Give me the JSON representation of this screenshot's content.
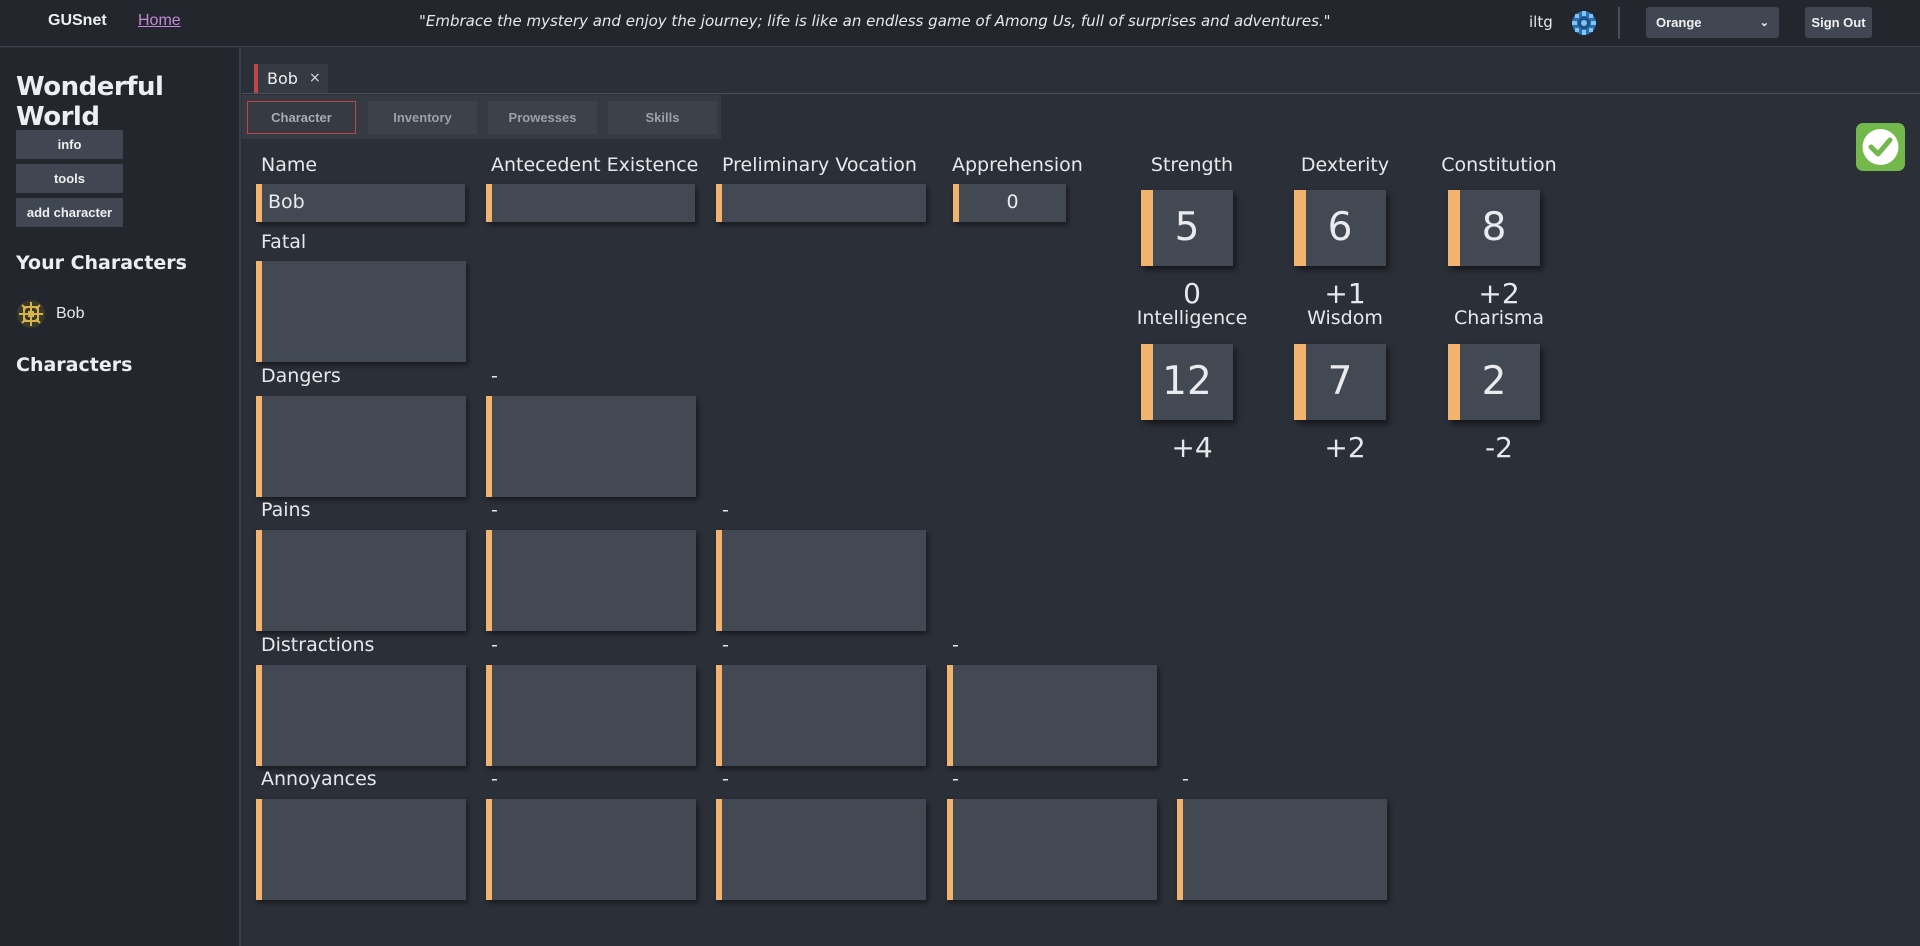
{
  "header": {
    "brand": "GUSnet",
    "home_link": "Home",
    "quote": "\"Embrace the mystery and enjoy the journey; life is like an endless game of Among Us, full of surprises and adventures.\"",
    "username": "iltg",
    "theme": "Orange",
    "sign_out": "Sign Out",
    "accent_color": "#f2b36f"
  },
  "sidebar": {
    "world_title": "Wonderful World",
    "buttons": [
      "info",
      "tools",
      "add character"
    ],
    "your_characters_heading": "Your Characters",
    "your_characters": [
      {
        "name": "Bob",
        "icon": "character-token-icon"
      }
    ],
    "characters_heading": "Characters"
  },
  "tabs": {
    "open_doc": "Bob",
    "close_glyph": "×",
    "sub_tabs": [
      "Character",
      "Inventory",
      "Prowesses",
      "Skills"
    ],
    "active_sub_tab": "Character"
  },
  "form": {
    "labels": {
      "name": "Name",
      "antecedent": "Antecedent Existence",
      "vocation": "Preliminary Vocation",
      "apprehension": "Apprehension",
      "fatal": "Fatal",
      "dangers": "Dangers",
      "pains": "Pains",
      "distractions": "Distractions",
      "annoyances": "Annoyances"
    },
    "values": {
      "name": "Bob",
      "antecedent": "",
      "vocation": "",
      "apprehension": "0"
    },
    "dash": "-"
  },
  "stats": [
    {
      "name": "Strength",
      "value": "5",
      "mod": "0"
    },
    {
      "name": "Dexterity",
      "value": "6",
      "mod": "+1"
    },
    {
      "name": "Constitution",
      "value": "8",
      "mod": "+2"
    },
    {
      "name": "Intelligence",
      "value": "12",
      "mod": "+4"
    },
    {
      "name": "Wisdom",
      "value": "7",
      "mod": "+2"
    },
    {
      "name": "Charisma",
      "value": "2",
      "mod": "-2"
    }
  ]
}
